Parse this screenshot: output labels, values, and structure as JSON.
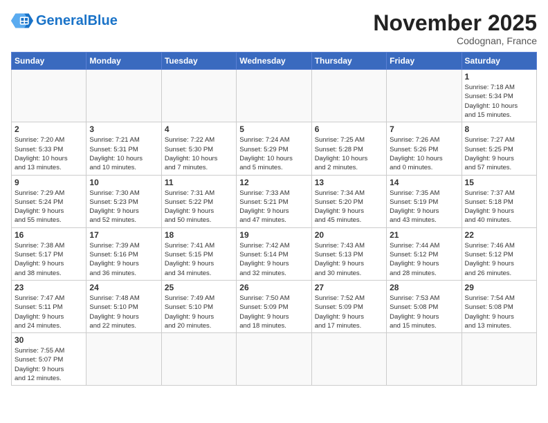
{
  "header": {
    "logo_general": "General",
    "logo_blue": "Blue",
    "month": "November 2025",
    "location": "Codognan, France"
  },
  "weekdays": [
    "Sunday",
    "Monday",
    "Tuesday",
    "Wednesday",
    "Thursday",
    "Friday",
    "Saturday"
  ],
  "weeks": [
    [
      {
        "day": "",
        "info": ""
      },
      {
        "day": "",
        "info": ""
      },
      {
        "day": "",
        "info": ""
      },
      {
        "day": "",
        "info": ""
      },
      {
        "day": "",
        "info": ""
      },
      {
        "day": "",
        "info": ""
      },
      {
        "day": "1",
        "info": "Sunrise: 7:18 AM\nSunset: 5:34 PM\nDaylight: 10 hours\nand 15 minutes."
      }
    ],
    [
      {
        "day": "2",
        "info": "Sunrise: 7:20 AM\nSunset: 5:33 PM\nDaylight: 10 hours\nand 13 minutes."
      },
      {
        "day": "3",
        "info": "Sunrise: 7:21 AM\nSunset: 5:31 PM\nDaylight: 10 hours\nand 10 minutes."
      },
      {
        "day": "4",
        "info": "Sunrise: 7:22 AM\nSunset: 5:30 PM\nDaylight: 10 hours\nand 7 minutes."
      },
      {
        "day": "5",
        "info": "Sunrise: 7:24 AM\nSunset: 5:29 PM\nDaylight: 10 hours\nand 5 minutes."
      },
      {
        "day": "6",
        "info": "Sunrise: 7:25 AM\nSunset: 5:28 PM\nDaylight: 10 hours\nand 2 minutes."
      },
      {
        "day": "7",
        "info": "Sunrise: 7:26 AM\nSunset: 5:26 PM\nDaylight: 10 hours\nand 0 minutes."
      },
      {
        "day": "8",
        "info": "Sunrise: 7:27 AM\nSunset: 5:25 PM\nDaylight: 9 hours\nand 57 minutes."
      }
    ],
    [
      {
        "day": "9",
        "info": "Sunrise: 7:29 AM\nSunset: 5:24 PM\nDaylight: 9 hours\nand 55 minutes."
      },
      {
        "day": "10",
        "info": "Sunrise: 7:30 AM\nSunset: 5:23 PM\nDaylight: 9 hours\nand 52 minutes."
      },
      {
        "day": "11",
        "info": "Sunrise: 7:31 AM\nSunset: 5:22 PM\nDaylight: 9 hours\nand 50 minutes."
      },
      {
        "day": "12",
        "info": "Sunrise: 7:33 AM\nSunset: 5:21 PM\nDaylight: 9 hours\nand 47 minutes."
      },
      {
        "day": "13",
        "info": "Sunrise: 7:34 AM\nSunset: 5:20 PM\nDaylight: 9 hours\nand 45 minutes."
      },
      {
        "day": "14",
        "info": "Sunrise: 7:35 AM\nSunset: 5:19 PM\nDaylight: 9 hours\nand 43 minutes."
      },
      {
        "day": "15",
        "info": "Sunrise: 7:37 AM\nSunset: 5:18 PM\nDaylight: 9 hours\nand 40 minutes."
      }
    ],
    [
      {
        "day": "16",
        "info": "Sunrise: 7:38 AM\nSunset: 5:17 PM\nDaylight: 9 hours\nand 38 minutes."
      },
      {
        "day": "17",
        "info": "Sunrise: 7:39 AM\nSunset: 5:16 PM\nDaylight: 9 hours\nand 36 minutes."
      },
      {
        "day": "18",
        "info": "Sunrise: 7:41 AM\nSunset: 5:15 PM\nDaylight: 9 hours\nand 34 minutes."
      },
      {
        "day": "19",
        "info": "Sunrise: 7:42 AM\nSunset: 5:14 PM\nDaylight: 9 hours\nand 32 minutes."
      },
      {
        "day": "20",
        "info": "Sunrise: 7:43 AM\nSunset: 5:13 PM\nDaylight: 9 hours\nand 30 minutes."
      },
      {
        "day": "21",
        "info": "Sunrise: 7:44 AM\nSunset: 5:12 PM\nDaylight: 9 hours\nand 28 minutes."
      },
      {
        "day": "22",
        "info": "Sunrise: 7:46 AM\nSunset: 5:12 PM\nDaylight: 9 hours\nand 26 minutes."
      }
    ],
    [
      {
        "day": "23",
        "info": "Sunrise: 7:47 AM\nSunset: 5:11 PM\nDaylight: 9 hours\nand 24 minutes."
      },
      {
        "day": "24",
        "info": "Sunrise: 7:48 AM\nSunset: 5:10 PM\nDaylight: 9 hours\nand 22 minutes."
      },
      {
        "day": "25",
        "info": "Sunrise: 7:49 AM\nSunset: 5:10 PM\nDaylight: 9 hours\nand 20 minutes."
      },
      {
        "day": "26",
        "info": "Sunrise: 7:50 AM\nSunset: 5:09 PM\nDaylight: 9 hours\nand 18 minutes."
      },
      {
        "day": "27",
        "info": "Sunrise: 7:52 AM\nSunset: 5:09 PM\nDaylight: 9 hours\nand 17 minutes."
      },
      {
        "day": "28",
        "info": "Sunrise: 7:53 AM\nSunset: 5:08 PM\nDaylight: 9 hours\nand 15 minutes."
      },
      {
        "day": "29",
        "info": "Sunrise: 7:54 AM\nSunset: 5:08 PM\nDaylight: 9 hours\nand 13 minutes."
      }
    ],
    [
      {
        "day": "30",
        "info": "Sunrise: 7:55 AM\nSunset: 5:07 PM\nDaylight: 9 hours\nand 12 minutes."
      },
      {
        "day": "",
        "info": ""
      },
      {
        "day": "",
        "info": ""
      },
      {
        "day": "",
        "info": ""
      },
      {
        "day": "",
        "info": ""
      },
      {
        "day": "",
        "info": ""
      },
      {
        "day": "",
        "info": ""
      }
    ]
  ]
}
